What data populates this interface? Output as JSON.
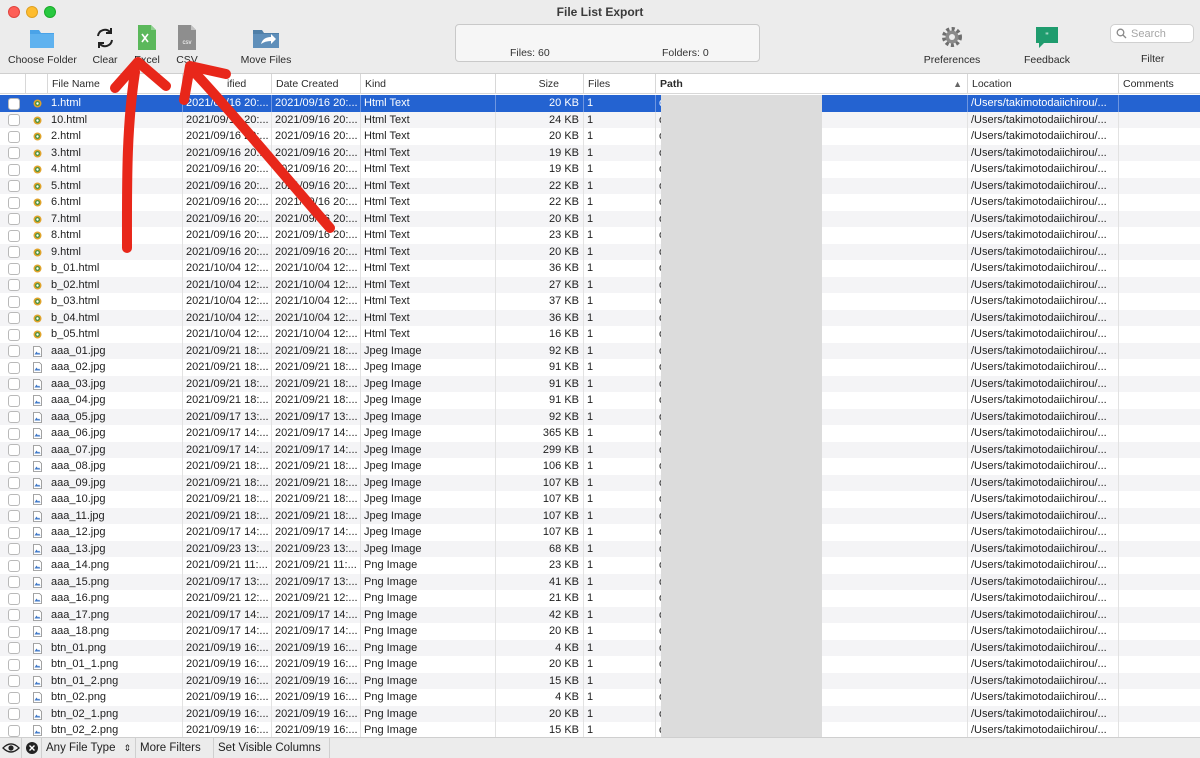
{
  "window": {
    "title": "File List Export"
  },
  "toolbar": {
    "choose_folder": "Choose Folder",
    "clear": "Clear",
    "excel": "Excel",
    "csv": "CSV",
    "move_files": "Move Files",
    "preferences": "Preferences",
    "feedback": "Feedback",
    "filter": "Filter",
    "search_placeholder": "Search",
    "csv_icon_text": "csv"
  },
  "status": {
    "files": "Files: 60",
    "folders": "Folders: 0"
  },
  "columns": [
    "File Name",
    "Date Modified",
    "Date Created",
    "Kind",
    "Size",
    "Files",
    "Path",
    "Location",
    "Comments"
  ],
  "visible_header_labels": {
    "date_modified_partial": "ified"
  },
  "rows": [
    {
      "name": "1.html",
      "modified": "2021/09/16 20:...",
      "created": "2021/09/16 20:...",
      "kind": "Html Text",
      "size": "20 KB",
      "files": "1",
      "path": "o/example/A/1.html",
      "location": "/Users/takimotodaiichirou/...",
      "icon": "html",
      "selected": true
    },
    {
      "name": "10.html",
      "modified": "2021/09/16 20:...",
      "created": "2021/09/16 20:...",
      "kind": "Html Text",
      "size": "24 KB",
      "files": "1",
      "path": "o/example/A/10.html",
      "location": "/Users/takimotodaiichirou/...",
      "icon": "html"
    },
    {
      "name": "2.html",
      "modified": "2021/09/16 20:...",
      "created": "2021/09/16 20:...",
      "kind": "Html Text",
      "size": "20 KB",
      "files": "1",
      "path": "o/example/A/2.html",
      "location": "/Users/takimotodaiichirou/...",
      "icon": "html"
    },
    {
      "name": "3.html",
      "modified": "2021/09/16 20:...",
      "created": "2021/09/16 20:...",
      "kind": "Html Text",
      "size": "19 KB",
      "files": "1",
      "path": "o/example/A/3.html",
      "location": "/Users/takimotodaiichirou/...",
      "icon": "html"
    },
    {
      "name": "4.html",
      "modified": "2021/09/16 20:...",
      "created": "2021/09/16 20:...",
      "kind": "Html Text",
      "size": "19 KB",
      "files": "1",
      "path": "o/example/A/4.html",
      "location": "/Users/takimotodaiichirou/...",
      "icon": "html"
    },
    {
      "name": "5.html",
      "modified": "2021/09/16 20:...",
      "created": "2021/09/16 20:...",
      "kind": "Html Text",
      "size": "22 KB",
      "files": "1",
      "path": "o/example/A/5.html",
      "location": "/Users/takimotodaiichirou/...",
      "icon": "html"
    },
    {
      "name": "6.html",
      "modified": "2021/09/16 20:...",
      "created": "2021/09/16 20:...",
      "kind": "Html Text",
      "size": "22 KB",
      "files": "1",
      "path": "o/example/A/6.html",
      "location": "/Users/takimotodaiichirou/...",
      "icon": "html"
    },
    {
      "name": "7.html",
      "modified": "2021/09/16 20:...",
      "created": "2021/09/16 20:...",
      "kind": "Html Text",
      "size": "20 KB",
      "files": "1",
      "path": "o/example/A/7.html",
      "location": "/Users/takimotodaiichirou/...",
      "icon": "html"
    },
    {
      "name": "8.html",
      "modified": "2021/09/16 20:...",
      "created": "2021/09/16 20:...",
      "kind": "Html Text",
      "size": "23 KB",
      "files": "1",
      "path": "o/example/A/8.html",
      "location": "/Users/takimotodaiichirou/...",
      "icon": "html"
    },
    {
      "name": "9.html",
      "modified": "2021/09/16 20:...",
      "created": "2021/09/16 20:...",
      "kind": "Html Text",
      "size": "20 KB",
      "files": "1",
      "path": "o/example/A/9.html",
      "location": "/Users/takimotodaiichirou/...",
      "icon": "html"
    },
    {
      "name": "b_01.html",
      "modified": "2021/10/04 12:...",
      "created": "2021/10/04 12:...",
      "kind": "Html Text",
      "size": "36 KB",
      "files": "1",
      "path": "o/example/B/b_01.html",
      "location": "/Users/takimotodaiichirou/...",
      "icon": "html"
    },
    {
      "name": "b_02.html",
      "modified": "2021/10/04 12:...",
      "created": "2021/10/04 12:...",
      "kind": "Html Text",
      "size": "27 KB",
      "files": "1",
      "path": "o/example/B/b_02.html",
      "location": "/Users/takimotodaiichirou/...",
      "icon": "html"
    },
    {
      "name": "b_03.html",
      "modified": "2021/10/04 12:...",
      "created": "2021/10/04 12:...",
      "kind": "Html Text",
      "size": "37 KB",
      "files": "1",
      "path": "o/example/B/b_03.html",
      "location": "/Users/takimotodaiichirou/...",
      "icon": "html"
    },
    {
      "name": "b_04.html",
      "modified": "2021/10/04 12:...",
      "created": "2021/10/04 12:...",
      "kind": "Html Text",
      "size": "36 KB",
      "files": "1",
      "path": "o/example/B/b_04.html",
      "location": "/Users/takimotodaiichirou/...",
      "icon": "html"
    },
    {
      "name": "b_05.html",
      "modified": "2021/10/04 12:...",
      "created": "2021/10/04 12:...",
      "kind": "Html Text",
      "size": "16 KB",
      "files": "1",
      "path": "o/example/B/b_05.html",
      "location": "/Users/takimotodaiichirou/...",
      "icon": "html"
    },
    {
      "name": "aaa_01.jpg",
      "modified": "2021/09/21 18:...",
      "created": "2021/09/21 18:...",
      "kind": "Jpeg Image",
      "size": "92 KB",
      "files": "1",
      "path": "o/example/B/img/aaa_01.jpg",
      "location": "/Users/takimotodaiichirou/...",
      "icon": "image"
    },
    {
      "name": "aaa_02.jpg",
      "modified": "2021/09/21 18:...",
      "created": "2021/09/21 18:...",
      "kind": "Jpeg Image",
      "size": "91 KB",
      "files": "1",
      "path": "o/example/B/img/aaa_02.jpg",
      "location": "/Users/takimotodaiichirou/...",
      "icon": "image"
    },
    {
      "name": "aaa_03.jpg",
      "modified": "2021/09/21 18:...",
      "created": "2021/09/21 18:...",
      "kind": "Jpeg Image",
      "size": "91 KB",
      "files": "1",
      "path": "o/example/B/img/aaa_03.jpg",
      "location": "/Users/takimotodaiichirou/...",
      "icon": "image"
    },
    {
      "name": "aaa_04.jpg",
      "modified": "2021/09/21 18:...",
      "created": "2021/09/21 18:...",
      "kind": "Jpeg Image",
      "size": "91 KB",
      "files": "1",
      "path": "o/example/B/img/aaa_04.jpg",
      "location": "/Users/takimotodaiichirou/...",
      "icon": "image"
    },
    {
      "name": "aaa_05.jpg",
      "modified": "2021/09/17 13:...",
      "created": "2021/09/17 13:...",
      "kind": "Jpeg Image",
      "size": "92 KB",
      "files": "1",
      "path": "o/example/B/img/aaa_05.jpg",
      "location": "/Users/takimotodaiichirou/...",
      "icon": "image"
    },
    {
      "name": "aaa_06.jpg",
      "modified": "2021/09/17 14:...",
      "created": "2021/09/17 14:...",
      "kind": "Jpeg Image",
      "size": "365 KB",
      "files": "1",
      "path": "o/example/B/img/aaa_06.jpg",
      "location": "/Users/takimotodaiichirou/...",
      "icon": "image"
    },
    {
      "name": "aaa_07.jpg",
      "modified": "2021/09/17 14:...",
      "created": "2021/09/17 14:...",
      "kind": "Jpeg Image",
      "size": "299 KB",
      "files": "1",
      "path": "o/example/B/img/aaa_07.jpg",
      "location": "/Users/takimotodaiichirou/...",
      "icon": "image"
    },
    {
      "name": "aaa_08.jpg",
      "modified": "2021/09/21 18:...",
      "created": "2021/09/21 18:...",
      "kind": "Jpeg Image",
      "size": "106 KB",
      "files": "1",
      "path": "o/example/B/img/aaa_08.jpg",
      "location": "/Users/takimotodaiichirou/...",
      "icon": "image"
    },
    {
      "name": "aaa_09.jpg",
      "modified": "2021/09/21 18:...",
      "created": "2021/09/21 18:...",
      "kind": "Jpeg Image",
      "size": "107 KB",
      "files": "1",
      "path": "o/example/B/img/aaa_09.jpg",
      "location": "/Users/takimotodaiichirou/...",
      "icon": "image"
    },
    {
      "name": "aaa_10.jpg",
      "modified": "2021/09/21 18:...",
      "created": "2021/09/21 18:...",
      "kind": "Jpeg Image",
      "size": "107 KB",
      "files": "1",
      "path": "o/example/B/img/aaa_10.jpg",
      "location": "/Users/takimotodaiichirou/...",
      "icon": "image"
    },
    {
      "name": "aaa_11.jpg",
      "modified": "2021/09/21 18:...",
      "created": "2021/09/21 18:...",
      "kind": "Jpeg Image",
      "size": "107 KB",
      "files": "1",
      "path": "o/example/B/img/aaa_11.jpg",
      "location": "/Users/takimotodaiichirou/...",
      "icon": "image"
    },
    {
      "name": "aaa_12.jpg",
      "modified": "2021/09/17 14:...",
      "created": "2021/09/17 14:...",
      "kind": "Jpeg Image",
      "size": "107 KB",
      "files": "1",
      "path": "o/example/B/img/aaa_12.jpg",
      "location": "/Users/takimotodaiichirou/...",
      "icon": "image"
    },
    {
      "name": "aaa_13.jpg",
      "modified": "2021/09/23 13:...",
      "created": "2021/09/23 13:...",
      "kind": "Jpeg Image",
      "size": "68 KB",
      "files": "1",
      "path": "o/example/B/img/aaa_13.jpg",
      "location": "/Users/takimotodaiichirou/...",
      "icon": "image"
    },
    {
      "name": "aaa_14.png",
      "modified": "2021/09/21 11:...",
      "created": "2021/09/21 11:...",
      "kind": "Png Image",
      "size": "23 KB",
      "files": "1",
      "path": "o/example/B/img/aaa_14.png",
      "location": "/Users/takimotodaiichirou/...",
      "icon": "image"
    },
    {
      "name": "aaa_15.png",
      "modified": "2021/09/17 13:...",
      "created": "2021/09/17 13:...",
      "kind": "Png Image",
      "size": "41 KB",
      "files": "1",
      "path": "o/example/B/img/aaa_15.png",
      "location": "/Users/takimotodaiichirou/...",
      "icon": "image"
    },
    {
      "name": "aaa_16.png",
      "modified": "2021/09/21 12:...",
      "created": "2021/09/21 12:...",
      "kind": "Png Image",
      "size": "21 KB",
      "files": "1",
      "path": "o/example/B/img/aaa_16.png",
      "location": "/Users/takimotodaiichirou/...",
      "icon": "image"
    },
    {
      "name": "aaa_17.png",
      "modified": "2021/09/17 14:...",
      "created": "2021/09/17 14:...",
      "kind": "Png Image",
      "size": "42 KB",
      "files": "1",
      "path": "o/example/B/img/aaa_17.png",
      "location": "/Users/takimotodaiichirou/...",
      "icon": "image"
    },
    {
      "name": "aaa_18.png",
      "modified": "2021/09/17 14:...",
      "created": "2021/09/17 14:...",
      "kind": "Png Image",
      "size": "20 KB",
      "files": "1",
      "path": "o/example/B/img/aaa_18.png",
      "location": "/Users/takimotodaiichirou/...",
      "icon": "image"
    },
    {
      "name": "btn_01.png",
      "modified": "2021/09/19 16:...",
      "created": "2021/09/19 16:...",
      "kind": "Png Image",
      "size": "4 KB",
      "files": "1",
      "path": "o/example/B/img/btn_01.png",
      "location": "/Users/takimotodaiichirou/...",
      "icon": "image"
    },
    {
      "name": "btn_01_1.png",
      "modified": "2021/09/19 16:...",
      "created": "2021/09/19 16:...",
      "kind": "Png Image",
      "size": "20 KB",
      "files": "1",
      "path": "o/example/B/img/btn_01_1....",
      "location": "/Users/takimotodaiichirou/...",
      "icon": "image"
    },
    {
      "name": "btn_01_2.png",
      "modified": "2021/09/19 16:...",
      "created": "2021/09/19 16:...",
      "kind": "Png Image",
      "size": "15 KB",
      "files": "1",
      "path": "o/example/B/img/btn_01_2....",
      "location": "/Users/takimotodaiichirou/...",
      "icon": "image"
    },
    {
      "name": "btn_02.png",
      "modified": "2021/09/19 16:...",
      "created": "2021/09/19 16:...",
      "kind": "Png Image",
      "size": "4 KB",
      "files": "1",
      "path": "o/example/B/img/btn_02.png",
      "location": "/Users/takimotodaiichirou/...",
      "icon": "image"
    },
    {
      "name": "btn_02_1.png",
      "modified": "2021/09/19 16:...",
      "created": "2021/09/19 16:...",
      "kind": "Png Image",
      "size": "20 KB",
      "files": "1",
      "path": "o/example/B/img/btn_02_1....",
      "location": "/Users/takimotodaiichirou/...",
      "icon": "image"
    },
    {
      "name": "btn_02_2.png",
      "modified": "2021/09/19 16:...",
      "created": "2021/09/19 16:...",
      "kind": "Png Image",
      "size": "15 KB",
      "files": "1",
      "path": "o/example/B/img/btn_02_2....",
      "location": "/Users/takimotodaiichirou/...",
      "icon": "image"
    }
  ],
  "bottombar": {
    "file_type": "Any File Type",
    "more_filters": "More Filters",
    "set_visible_columns": "Set Visible Columns"
  },
  "colors": {
    "selection": "#2463d1",
    "annotation_arrow": "#e8271a",
    "feedback_icon": "#1f9c6e",
    "excel_icon": "#5bb85b",
    "folder_icon": "#4aa3e8"
  }
}
